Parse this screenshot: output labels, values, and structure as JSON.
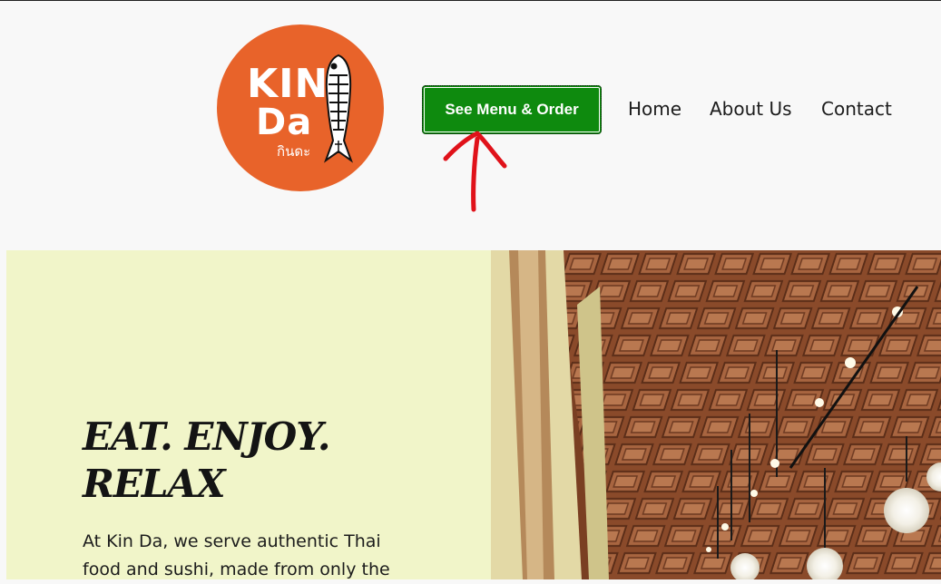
{
  "header": {
    "logo": {
      "brand_primary": "KIN",
      "brand_secondary": "Da",
      "brand_thai": "กินดะ",
      "color": "#e8632a",
      "icon": "koi-fish-icon"
    },
    "cta_label": "See Menu & Order",
    "cta_color": "#0e8a0e",
    "nav": [
      {
        "label": "Home"
      },
      {
        "label": "About Us"
      },
      {
        "label": "Contact"
      }
    ],
    "annotation": {
      "icon": "red-arrow-icon",
      "color": "#e0121a"
    }
  },
  "hero": {
    "headline_line1": "EAT. ENJOY.",
    "headline_line2": "RELAX",
    "intro": "At Kin Da, we serve authentic Thai food and sushi, made from only the",
    "background": "#f1f5c9",
    "photo": "restaurant-interior-image"
  }
}
